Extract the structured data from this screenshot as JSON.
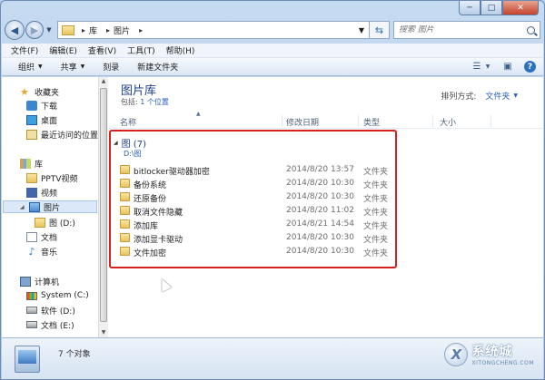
{
  "window": {
    "caption_min": "─",
    "caption_max": "□",
    "caption_close": "✕"
  },
  "address_bar": {
    "breadcrumbs": [
      "库",
      "图片"
    ],
    "separator": "▸",
    "search_placeholder": "搜索 图片"
  },
  "menu": [
    "文件(F)",
    "编辑(E)",
    "查看(V)",
    "工具(T)",
    "帮助(H)"
  ],
  "toolbar": {
    "organize": "组织",
    "share": "共享",
    "burn": "刻录",
    "new_folder": "新建文件夹",
    "help_glyph": "?"
  },
  "nav_pane": {
    "favorites": "收藏夹",
    "downloads": "下载",
    "desktop": "桌面",
    "recent": "最近访问的位置",
    "libraries": "库",
    "pptv": "PPTV视频",
    "videos": "视频",
    "pictures": "图片",
    "pictures_child": "图 (D:)",
    "documents": "文档",
    "music": "音乐",
    "computer": "计算机",
    "drive_c": "System (C:)",
    "drive_d": "软件 (D:)",
    "drive_e": "文档 (E:)"
  },
  "library": {
    "title": "图片库",
    "includes_label": "包括:",
    "includes_link": "1 个位置",
    "arrange_label": "排列方式:",
    "arrange_value": "文件夹"
  },
  "columns": {
    "name": "名称",
    "date": "修改日期",
    "type": "类型",
    "size": "大小"
  },
  "group": {
    "title": "图 (7)",
    "path": "D:\\图"
  },
  "rows": [
    {
      "name": "bitlocker驱动器加密",
      "date": "2014/8/20 13:57",
      "type": "文件夹"
    },
    {
      "name": "备份系统",
      "date": "2014/8/20 10:30",
      "type": "文件夹"
    },
    {
      "name": "还原备份",
      "date": "2014/8/20 10:30",
      "type": "文件夹"
    },
    {
      "name": "取消文件隐藏",
      "date": "2014/8/20 11:02",
      "type": "文件夹"
    },
    {
      "name": "添加库",
      "date": "2014/8/21 14:54",
      "type": "文件夹"
    },
    {
      "name": "添加显卡驱动",
      "date": "2014/8/20 10:30",
      "type": "文件夹"
    },
    {
      "name": "文件加密",
      "date": "2014/8/20 10:30",
      "type": "文件夹"
    }
  ],
  "status": {
    "count": "7 个对象"
  },
  "watermark": {
    "logo": "X",
    "title": "系统城",
    "url": "XITONGCHENG.COM"
  },
  "colors": {
    "highlight_box": "#d81e1e",
    "link_blue": "#2761b8",
    "title_blue": "#1e3f87"
  }
}
